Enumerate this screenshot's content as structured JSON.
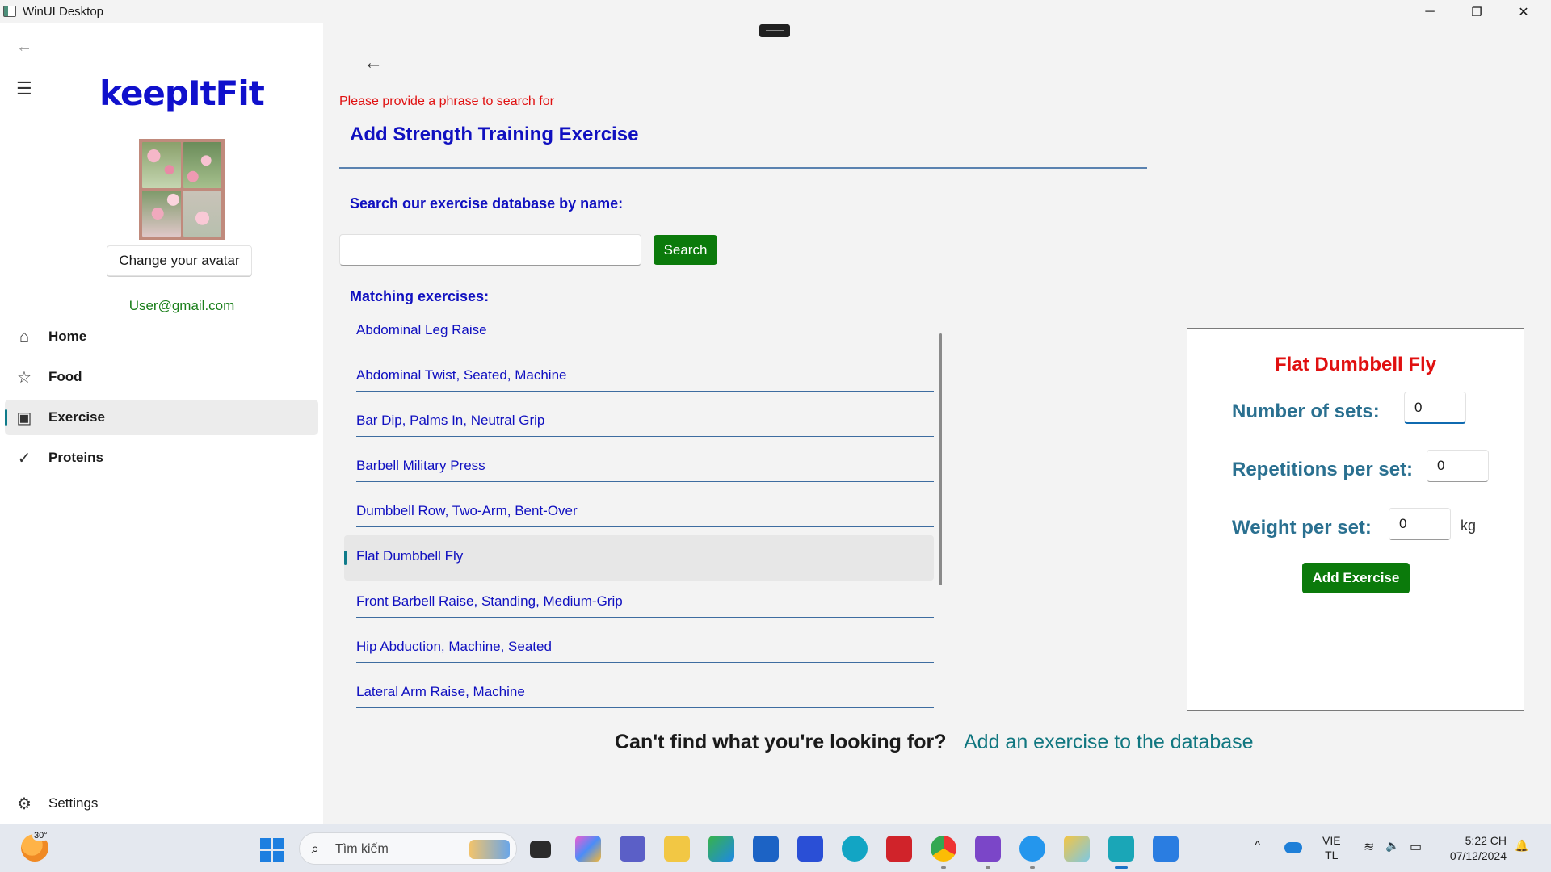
{
  "window": {
    "title": "WinUI Desktop",
    "minimize": "─",
    "restore": "❐",
    "close": "✕"
  },
  "nav": {
    "back_icon": "←",
    "menu_icon": "☰",
    "logo": "keepItFit",
    "avatar_button": "Change your avatar",
    "email": "User@gmail.com",
    "items": [
      {
        "label": "Home",
        "icon": "⌂",
        "selected": false
      },
      {
        "label": "Food",
        "icon": "☆",
        "selected": false
      },
      {
        "label": "Exercise",
        "icon": "▣",
        "selected": true
      },
      {
        "label": "Proteins",
        "icon": "✓",
        "selected": false
      }
    ],
    "settings": {
      "label": "Settings",
      "icon": "⚙"
    }
  },
  "page": {
    "back_icon": "←",
    "error": "Please provide a phrase to search for",
    "title": "Add Strength Training Exercise",
    "search_label": "Search our exercise database by name:",
    "search_value": "",
    "search_button": "Search",
    "matching_label": "Matching exercises:",
    "exercises": [
      "Abdominal Leg Raise",
      "Abdominal Twist, Seated, Machine",
      "Bar Dip, Palms In, Neutral Grip",
      "Barbell Military Press",
      "Dumbbell Row, Two-Arm, Bent-Over",
      "Flat Dumbbell Fly",
      "Front Barbell Raise, Standing, Medium-Grip",
      "Hip Abduction, Machine, Seated",
      "Lateral Arm Raise, Machine"
    ],
    "selected_index": 5,
    "footer_question": "Can't find what you're looking for?",
    "footer_link": "Add an exercise to the database"
  },
  "detail": {
    "title": "Flat Dumbbell Fly",
    "sets_label": "Number of sets:",
    "sets_value": "0",
    "reps_label": "Repetitions per set:",
    "reps_value": "0",
    "weight_label": "Weight per set:",
    "weight_value": "0",
    "weight_unit": "kg",
    "add_button": "Add Exercise"
  },
  "taskbar": {
    "weather_temp": "30°",
    "search_placeholder": "Tìm kiếm",
    "search_icon": "⌕",
    "lang_line1": "VIE",
    "lang_line2": "TL",
    "time": "5:22 CH",
    "date": "07/12/2024",
    "chevron": "^",
    "wifi": "≋",
    "volume": "🔈",
    "battery": "▭",
    "bell": "🔔"
  }
}
